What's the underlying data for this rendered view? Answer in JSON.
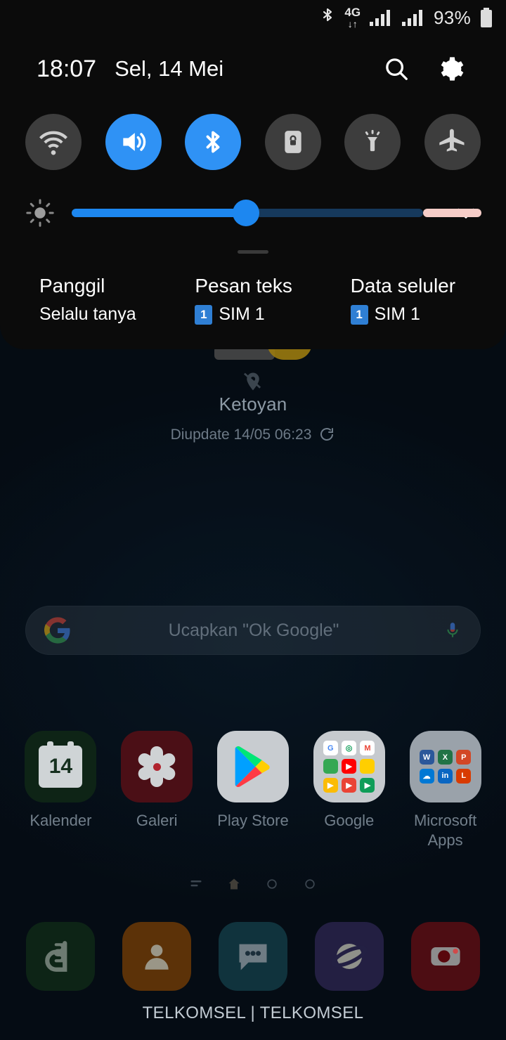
{
  "statusbar": {
    "bluetooth_icon": "bluetooth-icon",
    "network_type": "4G",
    "signal_icon_1": "signal-bars-icon",
    "signal_icon_2": "signal-bars-icon",
    "battery_percent": "93%",
    "battery_icon": "battery-icon"
  },
  "quick_panel": {
    "clock": "18:07",
    "date": "Sel, 14 Mei",
    "search_icon": "search-icon",
    "settings_icon": "gear-icon",
    "toggles": [
      {
        "name": "wifi",
        "icon": "wifi-icon",
        "active": false
      },
      {
        "name": "sound",
        "icon": "volume-icon",
        "active": true
      },
      {
        "name": "bluetooth",
        "icon": "bluetooth-icon",
        "active": true
      },
      {
        "name": "auto-rotate",
        "icon": "screen-lock-rotation-icon",
        "active": false
      },
      {
        "name": "flashlight",
        "icon": "flashlight-icon",
        "active": false
      },
      {
        "name": "airplane-mode",
        "icon": "airplane-icon",
        "active": false
      }
    ],
    "brightness": {
      "icon": "brightness-icon",
      "value_percent": 42,
      "expand_icon": "chevron-down-icon"
    },
    "sim_items": [
      {
        "title": "Panggil",
        "subtitle": "Selalu tanya",
        "badge": ""
      },
      {
        "title": "Pesan teks",
        "subtitle": "SIM 1",
        "badge": "1"
      },
      {
        "title": "Data seluler",
        "subtitle": "SIM 1",
        "badge": "1"
      }
    ]
  },
  "home": {
    "weather": {
      "location_off_icon": "location-off-icon",
      "city": "Ketoyan",
      "updated": "Diupdate 14/05 06:23",
      "refresh_icon": "refresh-icon"
    },
    "search": {
      "logo": "google-logo-icon",
      "placeholder": "Ucapkan \"Ok Google\"",
      "mic_icon": "microphone-icon"
    },
    "apps": [
      {
        "label": "Kalender",
        "icon": "calendar-icon",
        "badge": "14"
      },
      {
        "label": "Galeri",
        "icon": "gallery-flower-icon"
      },
      {
        "label": "Play Store",
        "icon": "play-store-icon"
      },
      {
        "label": "Google",
        "icon": "folder-google-icon"
      },
      {
        "label": "Microsoft Apps",
        "icon": "folder-microsoft-icon"
      }
    ],
    "page_indicators": [
      "bixby-home-icon",
      "home-page-icon",
      "page-dot-icon",
      "page-dot-icon"
    ],
    "dock": [
      {
        "label": "Phone",
        "icon": "phone-icon"
      },
      {
        "label": "Contacts",
        "icon": "contacts-icon"
      },
      {
        "label": "Messages",
        "icon": "messages-icon"
      },
      {
        "label": "Internet",
        "icon": "internet-icon"
      },
      {
        "label": "Camera",
        "icon": "camera-icon"
      }
    ],
    "carrier": "TELKOMSEL | TELKOMSEL"
  },
  "colors": {
    "accent_blue": "#2f92f5",
    "panel_bg": "#0b0b0b",
    "slider_pink": "#f6cdc8"
  }
}
